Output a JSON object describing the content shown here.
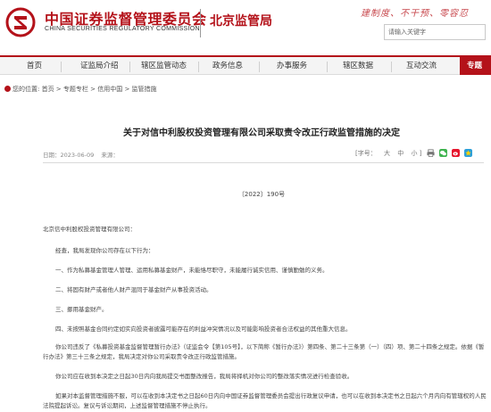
{
  "header": {
    "org_cn": "中国证券监督管理委员会",
    "org_en": "CHINA SECURITIES REGULATORY COMMISSION",
    "bureau": "北京监管局",
    "slogan": "建制度、不干预、零容忍",
    "search_placeholder": "请输入关键字",
    "brand_color": "#b4121a"
  },
  "nav": {
    "items": [
      "首页",
      "证监局介绍",
      "辖区监管动态",
      "政务信息",
      "办事服务",
      "辖区数据",
      "互动交流"
    ],
    "active": "专题"
  },
  "breadcrumb": "您的位置: 首页 > 专题专栏 > 信用中国 > 监管措施",
  "article": {
    "title": "关于对信中利股权投资管理有限公司采取责令改正行政监管措施的决定",
    "date": "日期：2023-06-09",
    "source": "来源：",
    "font_label": "[字号：",
    "font_sizes": [
      "大",
      "中",
      "小"
    ],
    "font_close": "]",
    "doc_no": "〔2022〕190号",
    "addressee": "北京信中利股权投资管理有限公司：",
    "paragraphs": [
      "经查，我局发现你公司存在以下行为：",
      "一、作为私募基金管理人管理、运用私募基金财产，未能恪尽职守，未能履行诚实信用、谨慎勤勉的义务。",
      "二、将固有财产或者他人财产混同于基金财产从事投资活动。",
      "三、挪用基金财产。",
      "四、未按照基金合同约定如实向投资者披露可能存在的利益冲突情况以及可能影响投资者合法权益的其他重大信息。",
      "你公司违反了《私募投资基金监督管理暂行办法》（证监会令【第105号】，以下简称《暂行办法》）第四条、第二十三条第（一）（四）项、第二十四条之规定。依据《暂行办法》第三十三条之规定，我局决定对你公司采取责令改正行政监管措施。",
      "你公司应在收到本决定之日起30日内向我局提交书面整改报告，我局将择机对你公司的整改落实情况进行检查验收。",
      "如果对本监督管理措施不服，可以在收到本决定书之日起60日内向中国证券监督管理委员会提出行政复议申请，也可以在收到本决定书之日起六个月内向有管辖权的人民法院提起诉讼。复议与诉讼期间，上述监督管理措施不停止执行。"
    ]
  },
  "icons": {
    "logo": "csrc-emblem-icon",
    "print": "print-icon",
    "wechat": "wechat-icon",
    "weibo": "weibo-icon",
    "qzone": "qzone-icon"
  }
}
